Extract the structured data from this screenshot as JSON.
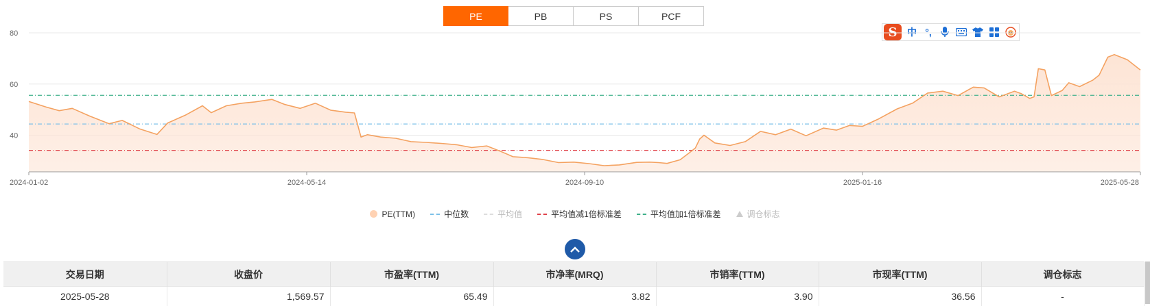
{
  "tabs": [
    {
      "label": "PE",
      "active": true
    },
    {
      "label": "PB",
      "active": false
    },
    {
      "label": "PS",
      "active": false
    },
    {
      "label": "PCF",
      "active": false
    }
  ],
  "ime": {
    "logo": "S",
    "items": [
      "中",
      "°,",
      "mic-icon",
      "keyboard-icon",
      "shirt-icon",
      "grid-icon",
      "avatar-icon"
    ]
  },
  "chart_data": {
    "type": "line",
    "ylim": [
      25.7,
      80
    ],
    "yticks": [
      40,
      60,
      80
    ],
    "grid": true,
    "x_ticks": [
      "2024-01-02",
      "2024-05-14",
      "2024-09-10",
      "2025-01-16",
      "2025-05-28"
    ],
    "x_start": "2024-01-02",
    "x_end": "2025-05-28",
    "series": [
      {
        "name": "PE(TTM)",
        "style": "area",
        "color": "#f4a261",
        "fill": "#fde3d3",
        "points": [
          [
            "2024-01-02",
            53.2
          ],
          [
            "2024-01-10",
            51.0
          ],
          [
            "2024-01-16",
            49.6
          ],
          [
            "2024-01-22",
            50.5
          ],
          [
            "2024-01-30",
            47.5
          ],
          [
            "2024-02-08",
            44.5
          ],
          [
            "2024-02-14",
            45.8
          ],
          [
            "2024-02-22",
            42.5
          ],
          [
            "2024-03-01",
            40.3
          ],
          [
            "2024-03-06",
            44.8
          ],
          [
            "2024-03-14",
            47.8
          ],
          [
            "2024-03-22",
            51.5
          ],
          [
            "2024-03-26",
            48.8
          ],
          [
            "2024-04-02",
            51.5
          ],
          [
            "2024-04-09",
            52.5
          ],
          [
            "2024-04-15",
            53.0
          ],
          [
            "2024-04-23",
            54.0
          ],
          [
            "2024-04-29",
            52.0
          ],
          [
            "2024-05-06",
            50.5
          ],
          [
            "2024-05-13",
            52.5
          ],
          [
            "2024-05-20",
            49.8
          ],
          [
            "2024-05-27",
            49.0
          ],
          [
            "2024-05-31",
            48.7
          ],
          [
            "2024-06-03",
            39.3
          ],
          [
            "2024-06-06",
            40.2
          ],
          [
            "2024-06-12",
            39.3
          ],
          [
            "2024-06-19",
            38.8
          ],
          [
            "2024-06-26",
            37.5
          ],
          [
            "2024-07-03",
            37.2
          ],
          [
            "2024-07-10",
            36.8
          ],
          [
            "2024-07-17",
            36.3
          ],
          [
            "2024-07-24",
            35.2
          ],
          [
            "2024-07-31",
            35.8
          ],
          [
            "2024-08-06",
            33.8
          ],
          [
            "2024-08-12",
            31.6
          ],
          [
            "2024-08-19",
            31.2
          ],
          [
            "2024-08-26",
            30.5
          ],
          [
            "2024-09-02",
            29.3
          ],
          [
            "2024-09-09",
            29.5
          ],
          [
            "2024-09-16",
            28.9
          ],
          [
            "2024-09-23",
            28.1
          ],
          [
            "2024-09-30",
            28.4
          ],
          [
            "2024-10-08",
            29.4
          ],
          [
            "2024-10-14",
            29.5
          ],
          [
            "2024-10-18",
            29.3
          ],
          [
            "2024-10-22",
            29.0
          ],
          [
            "2024-10-28",
            30.4
          ],
          [
            "2024-11-01",
            33.0
          ],
          [
            "2024-11-04",
            35.0
          ],
          [
            "2024-11-06",
            38.5
          ],
          [
            "2024-11-08",
            40.0
          ],
          [
            "2024-11-13",
            37.0
          ],
          [
            "2024-11-20",
            36.0
          ],
          [
            "2024-11-27",
            37.5
          ],
          [
            "2024-12-04",
            41.5
          ],
          [
            "2024-12-11",
            40.2
          ],
          [
            "2024-12-18",
            42.4
          ],
          [
            "2024-12-25",
            39.8
          ],
          [
            "2025-01-02",
            42.8
          ],
          [
            "2025-01-08",
            42.0
          ],
          [
            "2025-01-14",
            43.8
          ],
          [
            "2025-01-20",
            43.5
          ],
          [
            "2025-01-27",
            46.2
          ],
          [
            "2025-02-05",
            50.3
          ],
          [
            "2025-02-12",
            52.5
          ],
          [
            "2025-02-19",
            56.5
          ],
          [
            "2025-02-26",
            57.2
          ],
          [
            "2025-03-05",
            55.5
          ],
          [
            "2025-03-12",
            58.8
          ],
          [
            "2025-03-17",
            58.5
          ],
          [
            "2025-03-24",
            55.0
          ],
          [
            "2025-03-31",
            57.2
          ],
          [
            "2025-04-03",
            56.3
          ],
          [
            "2025-04-07",
            54.4
          ],
          [
            "2025-04-09",
            55.0
          ],
          [
            "2025-04-11",
            66.0
          ],
          [
            "2025-04-14",
            65.5
          ],
          [
            "2025-04-17",
            55.5
          ],
          [
            "2025-04-22",
            57.5
          ],
          [
            "2025-04-25",
            60.5
          ],
          [
            "2025-04-30",
            59.0
          ],
          [
            "2025-05-06",
            61.5
          ],
          [
            "2025-05-09",
            63.5
          ],
          [
            "2025-05-13",
            70.5
          ],
          [
            "2025-05-16",
            71.5
          ],
          [
            "2025-05-19",
            70.5
          ],
          [
            "2025-05-22",
            69.5
          ],
          [
            "2025-05-26",
            66.8
          ],
          [
            "2025-05-28",
            65.5
          ]
        ]
      },
      {
        "name": "中位数",
        "style": "dash",
        "color": "#7cc0e8",
        "value": 44.4
      },
      {
        "name": "平均值",
        "style": "dash",
        "color": "#cccccc",
        "value": 44.6,
        "hidden": true
      },
      {
        "name": "平均值减1倍标准差",
        "style": "dash",
        "color": "#e0424a",
        "value": 34.1
      },
      {
        "name": "平均值加1倍标准差",
        "style": "dash",
        "color": "#3fb08a",
        "value": 55.6
      },
      {
        "name": "调仓标志",
        "style": "marker",
        "hidden": true
      }
    ]
  },
  "legend": [
    {
      "label": "PE(TTM)",
      "kind": "dot",
      "active": true
    },
    {
      "label": "中位数",
      "kind": "dash",
      "color": "#7cc0e8",
      "active": true
    },
    {
      "label": "平均值",
      "kind": "dash",
      "color": "#cccccc",
      "active": false
    },
    {
      "label": "平均值减1倍标准差",
      "kind": "dash",
      "color": "#e0424a",
      "active": true
    },
    {
      "label": "平均值加1倍标准差",
      "kind": "dash",
      "color": "#3fb08a",
      "active": true
    },
    {
      "label": "调仓标志",
      "kind": "triangle",
      "active": false
    }
  ],
  "table": {
    "headers": [
      "交易日期",
      "收盘价",
      "市盈率(TTM)",
      "市净率(MRQ)",
      "市销率(TTM)",
      "市现率(TTM)",
      "调仓标志"
    ],
    "rows": [
      [
        "2025-05-28",
        "1,569.57",
        "65.49",
        "3.82",
        "3.90",
        "36.56",
        "-"
      ]
    ]
  }
}
